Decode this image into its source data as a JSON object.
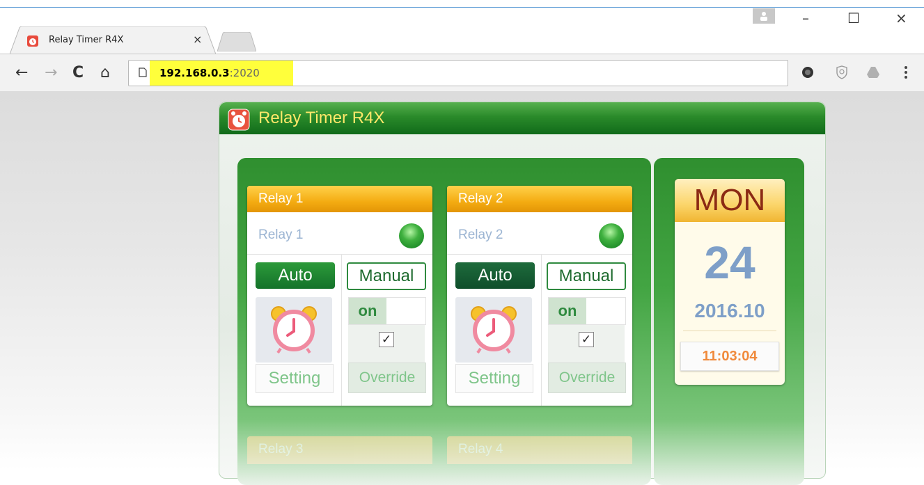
{
  "browser": {
    "tab": {
      "title": "Relay Timer R4X",
      "close_glyph": "×",
      "icon": "alarm-clock-icon"
    },
    "window_controls": {
      "minimize": "–",
      "maximize": "☐",
      "close": "×"
    },
    "nav": {
      "back": "←",
      "forward": "→",
      "reload": "C",
      "home": "⌂"
    },
    "address": {
      "host": "192.168.0.3",
      "port": ":2020",
      "highlight_color": "#ffff3b"
    },
    "extensions": [
      "globe-icon",
      "shield-icon",
      "drive-icon",
      "menu-icon"
    ]
  },
  "app": {
    "title": "Relay Timer R4X",
    "relays": [
      {
        "header": "Relay 1",
        "name": "Relay 1",
        "auto_label": "Auto",
        "manual_label": "Manual",
        "toggle_label": "on",
        "check": "✓",
        "setting_label": "Setting",
        "override_label": "Override"
      },
      {
        "header": "Relay 2",
        "name": "Relay 2",
        "auto_label": "Auto",
        "manual_label": "Manual",
        "toggle_label": "on",
        "check": "✓",
        "setting_label": "Setting",
        "override_label": "Override"
      }
    ],
    "faded_relays": [
      "Relay 3",
      "Relay 4"
    ],
    "date": {
      "day": "MON",
      "date_num": "24",
      "year_month": "2016.10",
      "time": "11:03:04"
    },
    "colors": {
      "header_green": "#2a8a2a",
      "title_yellow": "#ffe86a",
      "relay_header_orange": "#f4ac12",
      "date_blue": "#7e9fc8",
      "time_orange": "#f08a3c",
      "day_red": "#8b2a14"
    }
  }
}
